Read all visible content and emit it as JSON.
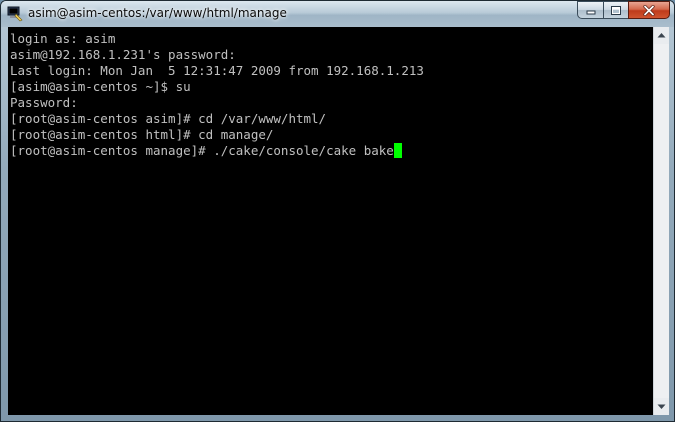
{
  "window": {
    "title": "asim@asim-centos:/var/www/html/manage"
  },
  "icons": {
    "app": "putty-icon",
    "minimize": "minimize-icon",
    "maximize": "maximize-icon",
    "close": "close-icon"
  },
  "colors": {
    "terminal_bg": "#000000",
    "terminal_text": "#c0c0c0",
    "cursor": "#00ff00",
    "close_button": "#c8452a"
  },
  "terminal": {
    "lines": [
      "login as: asim",
      "asim@192.168.1.231's password:",
      "Last login: Mon Jan  5 12:31:47 2009 from 192.168.1.213",
      "[asim@asim-centos ~]$ su",
      "Password:",
      "[root@asim-centos asim]# cd /var/www/html/",
      "[root@asim-centos html]# cd manage/",
      "[root@asim-centos manage]# ./cake/console/cake bake"
    ]
  }
}
